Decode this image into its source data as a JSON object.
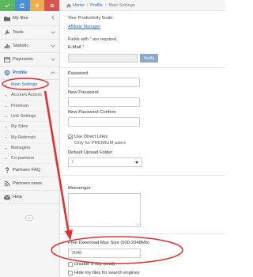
{
  "sidebar": {
    "top_buttons": [
      {
        "color": "#5cb85c",
        "icon": "check-icon"
      },
      {
        "color": "#4a90d9",
        "icon": "refresh-icon"
      },
      {
        "color": "#f0ad4e",
        "icon": "plus-icon"
      },
      {
        "color": "#d9534f",
        "icon": "gear-icon"
      }
    ],
    "items": [
      {
        "label": "My files",
        "icon": "folder-icon"
      },
      {
        "label": "Tools",
        "icon": "wrench-icon"
      },
      {
        "label": "Statistic",
        "icon": "chart-icon"
      },
      {
        "label": "Payments",
        "icon": "card-icon"
      },
      {
        "label": "Profile",
        "icon": "gear-icon"
      }
    ],
    "profile_sub": [
      "Main Settings",
      "Account Access",
      "Premium",
      "Link Settings",
      "My Sites",
      "My Referrals",
      "Managers",
      "Co-partners"
    ],
    "bottom_items": [
      {
        "label": "Partners FAQ",
        "icon": "question-icon"
      },
      {
        "label": "Partners news",
        "icon": "rss-icon"
      },
      {
        "label": "Help",
        "icon": "envelope-icon"
      }
    ],
    "collapse_glyph": "«"
  },
  "breadcrumb": {
    "home": "Home",
    "profile": "Profile",
    "current": "Main Settings",
    "separator": "/"
  },
  "form": {
    "scale_label": "Your Productivity Scale:",
    "scale_link": "Affiliate Manager",
    "required_prefix": "Fields with",
    "required_star": "*",
    "required_suffix": "are required.",
    "email_label": "E-Mail",
    "email_star": "*",
    "verify_label": "Verify",
    "password_label": "Password",
    "new_password_label": "New Password",
    "confirm_password_label": "New Password Confirm",
    "direct_links_label": "Use Direct Links",
    "direct_links_note": "Only for PREMIUM users",
    "upload_folder_label": "Default Upload Folder",
    "upload_folder_value": "/",
    "messenger_label": "Messenger",
    "max_size_label": "Free Download Max Size (500-2048Mb)",
    "max_size_value": "2048",
    "disable_label": "Disable 3 day (until)",
    "hide_files_label": "Hide my files for search engines"
  },
  "colors": {
    "accent": "#2a6ebb",
    "annotation": "#e03030"
  }
}
